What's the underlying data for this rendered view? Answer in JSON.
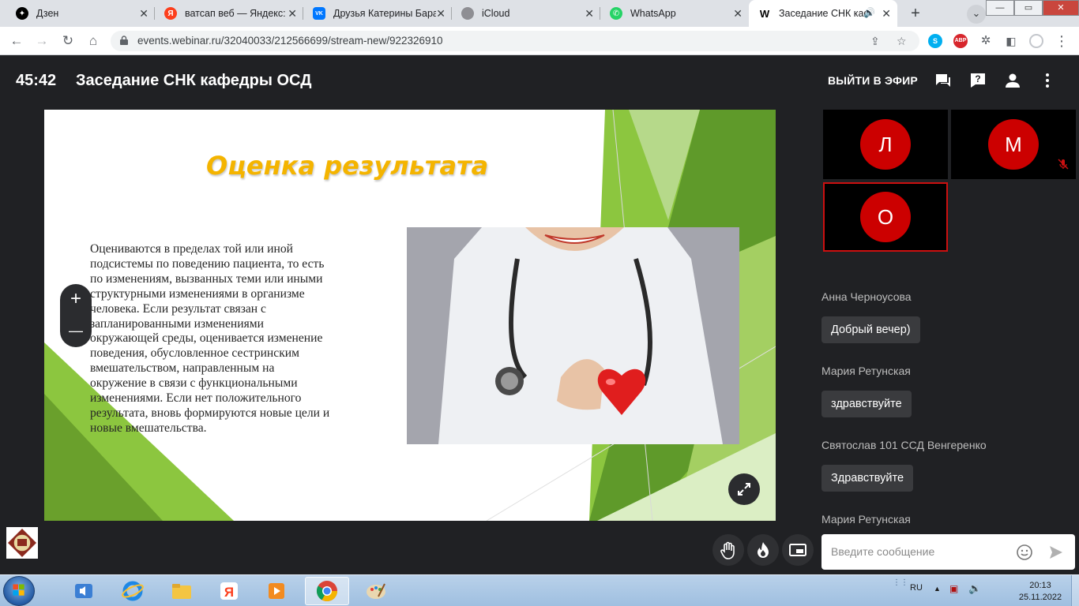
{
  "browser": {
    "tabs": [
      {
        "title": "Дзен",
        "icon": "dzen-icon",
        "color": "#000000",
        "glyph": "✦"
      },
      {
        "title": "ватсап веб — Яндекс: н",
        "icon": "yandex-icon",
        "color": "#fc3f1d",
        "glyph": "Я"
      },
      {
        "title": "Друзья Катерины Бара",
        "icon": "vk-icon",
        "color": "#0077ff",
        "glyph": "VK"
      },
      {
        "title": "iCloud",
        "icon": "apple-icon",
        "color": "#8e8e93",
        "glyph": ""
      },
      {
        "title": "WhatsApp",
        "icon": "whatsapp-icon",
        "color": "#25d366",
        "glyph": "✆"
      },
      {
        "title": "Заседание СНК каф",
        "icon": "webinar-icon",
        "color": "#000000",
        "glyph": "W"
      }
    ],
    "url": "events.webinar.ru/32040033/212566699/stream-new/922326910",
    "extensions": [
      {
        "name": "skype-icon",
        "label": "S",
        "color": "#00aff0"
      },
      {
        "name": "adblock-icon",
        "label": "ABP",
        "color": "#d7262c"
      }
    ]
  },
  "webinar": {
    "timer": "45:42",
    "title": "Заседание СНК кафедры ОСД",
    "go_live": "ВЫЙТИ В ЭФИР"
  },
  "slide": {
    "title": "Оценка результата",
    "text": "Оцениваются в пределах той или иной подсистемы по поведению пациента, то есть по изменениям, вызванных теми или иными структурными изменениями в организме человека. Если результат связан с запланированными изменениями окружающей среды, оценивается изменение поведения, обусловленное сестринским вмешательством, направленным на окружение в связи с функциональными изменениями. Если нет положительного результата, вновь формируются новые цели и новые вмешательства."
  },
  "zoom": {
    "plus": "+",
    "minus": "—"
  },
  "participants": [
    {
      "initial": "Л",
      "muted": false,
      "speaking": false
    },
    {
      "initial": "М",
      "muted": true,
      "speaking": false
    },
    {
      "initial": "О",
      "muted": false,
      "speaking": true
    }
  ],
  "chat": {
    "messages": [
      {
        "author": "Анна Черноусова",
        "text": "Добрый вечер)"
      },
      {
        "author": "Мария Ретунская",
        "text": "здравствуйте"
      },
      {
        "author": "Святослав 101 ССД Венгеренко",
        "text": "Здравствуйте"
      },
      {
        "author": "Мария Ретунская",
        "text": ""
      }
    ],
    "input_placeholder": "Введите сообщение"
  },
  "taskbar": {
    "lang": "RU",
    "time": "20:13",
    "date": "25.11.2022"
  },
  "colors": {
    "accent_red": "#cc0000",
    "slide_green": "#8cc63f",
    "title_gold": "#f4b400"
  }
}
